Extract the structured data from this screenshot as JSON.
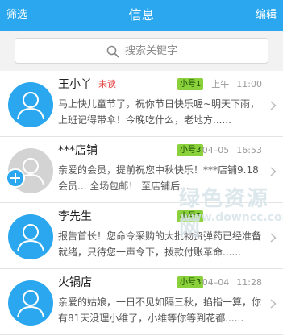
{
  "header": {
    "left_label": "筛选",
    "title": "信息",
    "right_label": "编辑"
  },
  "search": {
    "placeholder": "搜索关键字"
  },
  "messages": [
    {
      "name": "王小丫",
      "unread_label": "未读",
      "tag": "小号1",
      "date": "上午",
      "time": "11:00",
      "preview": "马上快儿童节了，祝你节日快乐喔~明天下雨，上班记得带伞！今晚吃什么，老地方......",
      "avatar": "default-blue"
    },
    {
      "name": "***店铺",
      "tag": "小号3",
      "date": "04–05",
      "time": "16:53",
      "preview": "亲爱的会员，提前祝您中秋快乐！***店铺9.18会员... 全场包邮！ 至店铺后...",
      "avatar": "default-gray-add"
    },
    {
      "name": "李先生",
      "tag": "小号3",
      "date": "",
      "time": "",
      "preview": "报告首长！您命令采购的大批物资弹药已经准备就绪，只待您一声令下，拨款付账革命......",
      "avatar": "default-blue"
    },
    {
      "name": "火锅店",
      "tag": "小号3",
      "date": "04–04",
      "time": "11:28",
      "preview": "亲爱的姑娘，一日不见如隔三秋，掐指一算，你有81天没理小维了，小维等你等到花都......",
      "avatar": "default-blue"
    }
  ],
  "watermark": {
    "text": "绿色资源网",
    "url": "www.downcc.com"
  },
  "colors": {
    "primary": "#2aa7ee",
    "tag_green": "#8bd13c",
    "unread_red": "#e23d3d"
  }
}
